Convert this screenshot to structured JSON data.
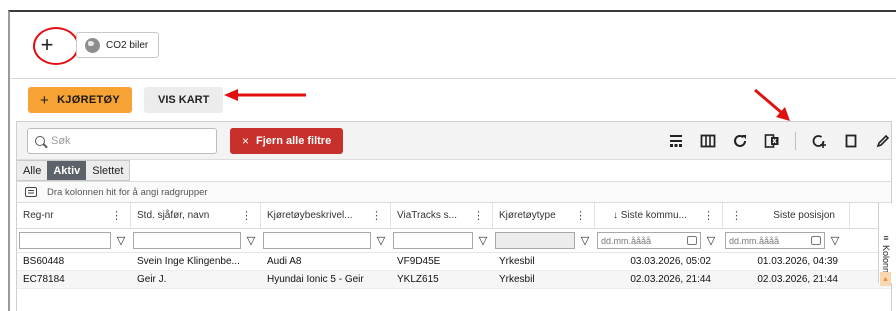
{
  "top": {
    "add_label": "+",
    "co2_label": "CO2 biler"
  },
  "actions": {
    "add_vehicle_plus": "+",
    "add_vehicle_label": "KJØRETØY",
    "show_map_label": "VIS KART"
  },
  "toolbar": {
    "search_placeholder": "Søk",
    "clear_filters_x": "×",
    "clear_filters_label": "Fjern alle filtre",
    "icons": [
      "density-icon",
      "columns-icon",
      "refresh-icon",
      "export-icon",
      "add-column-icon",
      "delete-icon",
      "edit-icon"
    ]
  },
  "tabs": [
    "Alle",
    "Aktiv",
    "Slettet"
  ],
  "active_tab": "Aktiv",
  "group_hint": "Dra kolonnen hit for å angi radgrupper",
  "columns": [
    {
      "label": "Reg-nr",
      "menu": "⋮"
    },
    {
      "label": "Std. sjåfør, navn",
      "menu": "⋮"
    },
    {
      "label": "Kjøretøybeskrivel...",
      "menu": "⋮"
    },
    {
      "label": "ViaTracks s...",
      "menu": "⋮"
    },
    {
      "label": "Kjøretøytype",
      "menu": "⋮"
    },
    {
      "label": "↓ Siste kommu...",
      "menu": "⋮"
    },
    {
      "label": "Siste posisjon",
      "menu": "⋮"
    }
  ],
  "date_placeholder": "dd.mm.åååå",
  "rows": [
    {
      "reg": "BS60448",
      "driver": "Svein Inge Klingenbe...",
      "desc": "Audi A8",
      "via": "VF9D45E",
      "type": "Yrkesbil",
      "last_comm": "03.03.2026, 05:02",
      "last_pos": "01.03.2026, 04:39"
    },
    {
      "reg": "EC78184",
      "driver": "Geir J.",
      "desc": "Hyundai Ionic 5 - Geir",
      "via": "YKLZ615",
      "type": "Yrkesbil",
      "last_comm": "02.03.2026, 21:44",
      "last_pos": "02.03.2026, 21:44"
    }
  ],
  "side_panel_label": "Kolonner",
  "colors": {
    "accent_orange": "#f6a234",
    "danger_red": "#c8302b",
    "active_tab": "#5c6269",
    "annotation_red": "#e01010"
  }
}
